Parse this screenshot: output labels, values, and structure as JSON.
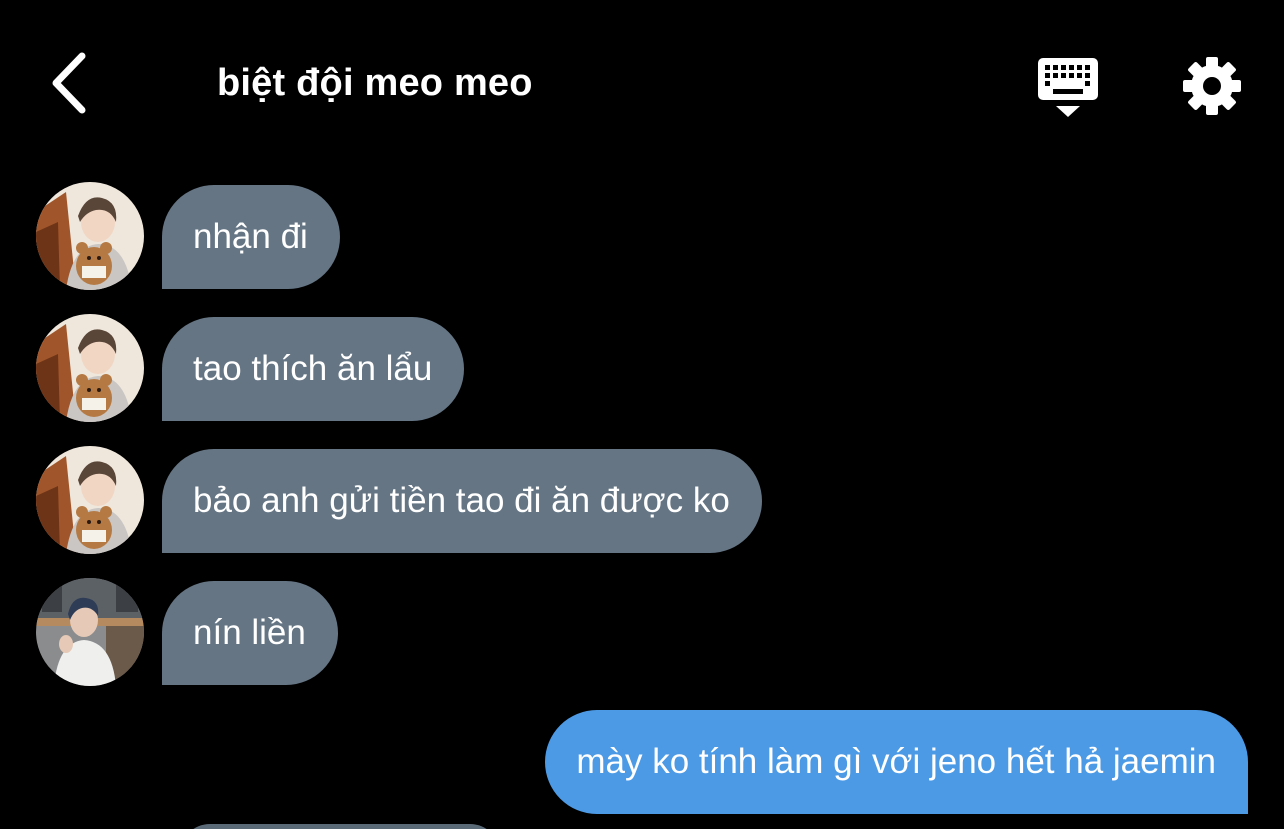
{
  "header": {
    "title": "biệt đội meo meo",
    "back_icon": "chevron-left-icon",
    "keyboard_icon": "keyboard-hide-icon",
    "settings_icon": "gear-icon"
  },
  "messages": [
    {
      "sender": "avatar-a",
      "direction": "incoming",
      "text": "nhận đi"
    },
    {
      "sender": "avatar-a",
      "direction": "incoming",
      "text": "tao thích ăn lẩu"
    },
    {
      "sender": "avatar-a",
      "direction": "incoming",
      "text": "bảo anh gửi tiền tao đi ăn được ko"
    },
    {
      "sender": "avatar-b",
      "direction": "incoming",
      "text": "nín liền"
    },
    {
      "sender": "me",
      "direction": "outgoing",
      "text": "mày ko tính làm gì với jeno hết hả jaemin"
    }
  ],
  "colors": {
    "background": "#000000",
    "incoming_bubble": "#657584",
    "outgoing_bubble": "#4c9ae6",
    "text": "#ffffff"
  }
}
